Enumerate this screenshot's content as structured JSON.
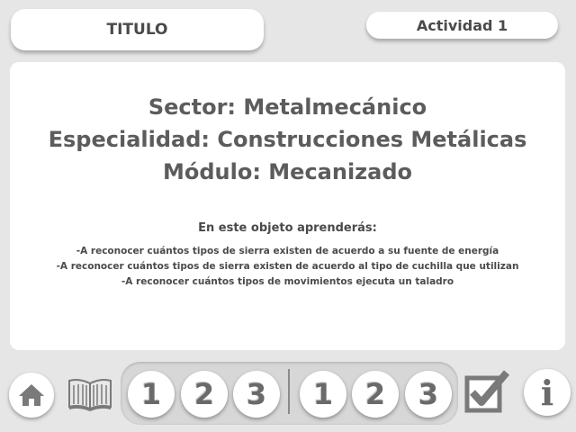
{
  "header": {
    "title_label": "TITULO",
    "activity_label": "Actividad 1"
  },
  "main": {
    "sector": "Sector: Metalmecánico",
    "specialty": "Especialidad: Construcciones Metálicas",
    "module": "Módulo: Mecanizado",
    "intro": "En este objeto aprenderás:",
    "objectives": [
      "-A reconocer cuántos tipos de sierra existen de acuerdo a su fuente de energía",
      "-A reconocer cuántos tipos de sierra existen de acuerdo al tipo de cuchilla que utilizan",
      "-A reconocer cuántos tipos de movimientos ejecuta un taladro"
    ]
  },
  "footer": {
    "home_icon": "home-icon",
    "book_icon": "book-icon",
    "group_a": [
      "1",
      "2",
      "3"
    ],
    "group_b": [
      "1",
      "2",
      "3"
    ],
    "check_icon": "checkbox-icon",
    "info_label": "i"
  },
  "colors": {
    "background": "#e6e6e6",
    "panel": "#ffffff",
    "text": "#5a5a5a",
    "icon": "#7a7a7a"
  }
}
